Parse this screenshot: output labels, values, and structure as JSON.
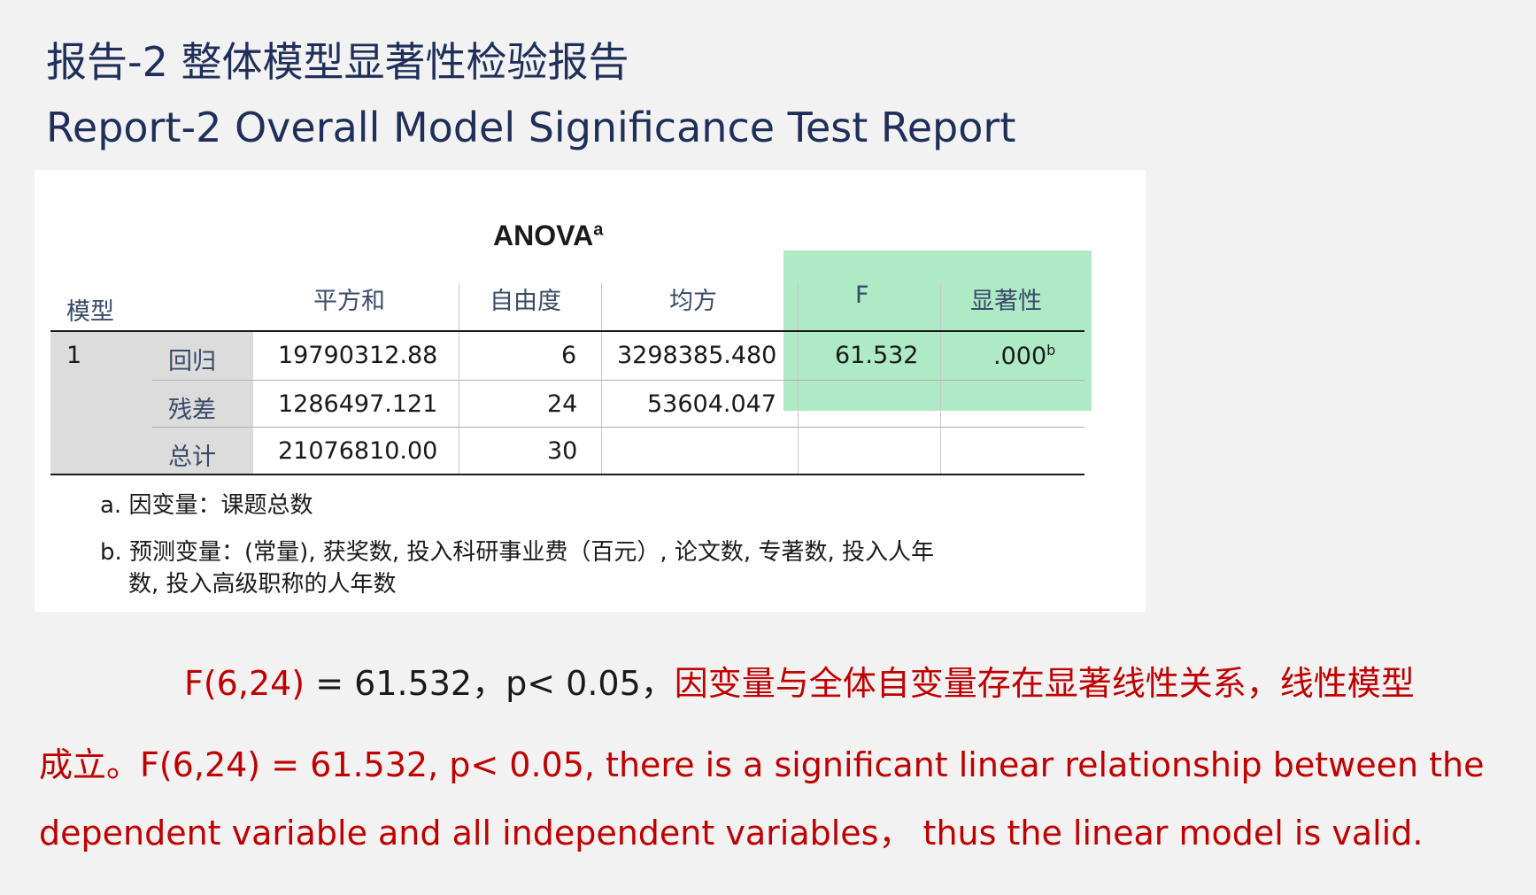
{
  "titles": {
    "cn": "报告-2 整体模型显著性检验报告",
    "en": "Report-2 Overall Model Significance Test Report"
  },
  "anova": {
    "title": "ANOVA",
    "title_sup": "a",
    "headers": {
      "model": "模型",
      "ss": "平方和",
      "df": "自由度",
      "ms": "均方",
      "f": "F",
      "sig": "显著性"
    },
    "model_number": "1",
    "rows": [
      {
        "label": "回归",
        "ss": "19790312.88",
        "df": "6",
        "ms": "3298385.480",
        "f": "61.532",
        "sig": ".000",
        "sig_sup": "b"
      },
      {
        "label": "残差",
        "ss": "1286497.121",
        "df": "24",
        "ms": "53604.047"
      },
      {
        "label": "总计",
        "ss": "21076810.00",
        "df": "30"
      }
    ],
    "notes": {
      "a": "a. 因变量：课题总数",
      "b_line1": "b. 预测变量：(常量), 获奖数, 投入科研事业费（百元）, 论文数, 专著数, 投入人年",
      "b_line2": "数, 投入高级职称的人年数"
    }
  },
  "conclusion": {
    "line1_red1": "F(6,24)",
    "line1_dark": "= 61.532，p< 0.05，",
    "line1_red2": "因变量与全体自变量存在显著线性关系，线性模型",
    "line2": "成立。F(6,24) = 61.532, p< 0.05, there is a significant linear relationship between the",
    "line3": "dependent variable and all independent variables， thus the linear model is valid."
  },
  "colors": {
    "title": "#1f2f5a",
    "conclusion_red": "#c00000",
    "highlight_green": "#5ed68c"
  }
}
